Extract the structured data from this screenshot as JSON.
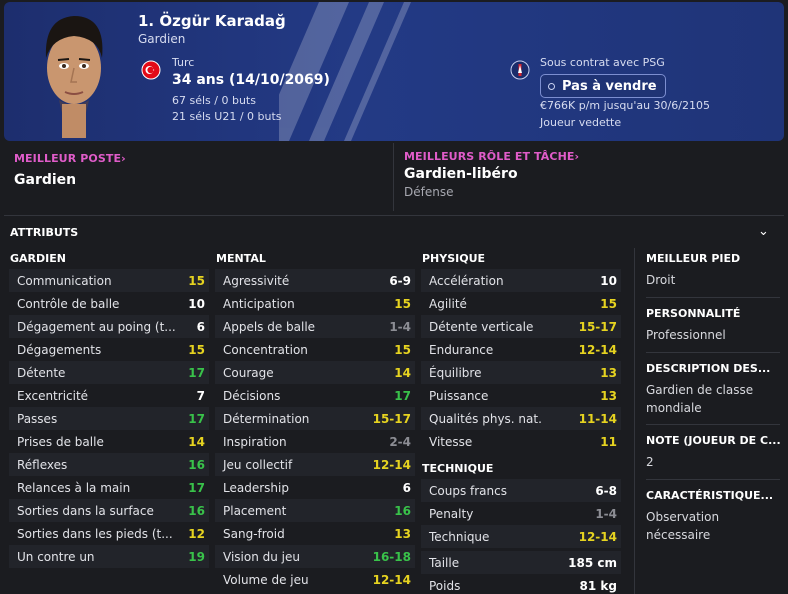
{
  "header": {
    "name": "1. Özgür Karadağ",
    "role": "Gardien",
    "nationality": "Turc",
    "age": "34 ans (14/10/2069)",
    "caps": "67 séls / 0 buts",
    "caps_u21": "21 séls U21 / 0 buts",
    "contract": "Sous contrat avec PSG",
    "sale_status": "Pas à vendre",
    "wage": "€766K p/m jusqu'au 30/6/2105",
    "squad_status": "Joueur vedette"
  },
  "best_position": {
    "title": "MEILLEUR POSTE",
    "value": "Gardien"
  },
  "best_role": {
    "title": "MEILLEURS RÔLE ET TÂCHE",
    "value": "Gardien-libéro",
    "duty": "Défense"
  },
  "attributes_title": "ATTRIBUTS",
  "colors": {
    "green": "#39c24a",
    "yellow": "#e6d320",
    "white": "#ffffff",
    "grey": "#8c8d94",
    "accent": "#e05cc9",
    "header_blue": "#233a85"
  },
  "gardien": {
    "title": "GARDIEN",
    "rows": [
      {
        "label": "Communication",
        "value": "15",
        "color": "yellow"
      },
      {
        "label": "Contrôle de balle",
        "value": "10",
        "color": "white"
      },
      {
        "label": "Dégagement au poing (t...",
        "value": "6",
        "color": "white"
      },
      {
        "label": "Dégagements",
        "value": "15",
        "color": "yellow"
      },
      {
        "label": "Détente",
        "value": "17",
        "color": "green"
      },
      {
        "label": "Excentricité",
        "value": "7",
        "color": "white"
      },
      {
        "label": "Passes",
        "value": "17",
        "color": "green"
      },
      {
        "label": "Prises de balle",
        "value": "14",
        "color": "yellow"
      },
      {
        "label": "Réflexes",
        "value": "16",
        "color": "green"
      },
      {
        "label": "Relances à la main",
        "value": "17",
        "color": "green"
      },
      {
        "label": "Sorties dans la surface",
        "value": "16",
        "color": "green"
      },
      {
        "label": "Sorties dans les pieds (t...",
        "value": "12",
        "color": "yellow"
      },
      {
        "label": "Un contre un",
        "value": "19",
        "color": "green"
      }
    ]
  },
  "mental": {
    "title": "MENTAL",
    "rows": [
      {
        "label": "Agressivité",
        "value": "6-9",
        "color": "white"
      },
      {
        "label": "Anticipation",
        "value": "15",
        "color": "yellow"
      },
      {
        "label": "Appels de balle",
        "value": "1-4",
        "color": "grey"
      },
      {
        "label": "Concentration",
        "value": "15",
        "color": "yellow"
      },
      {
        "label": "Courage",
        "value": "14",
        "color": "yellow"
      },
      {
        "label": "Décisions",
        "value": "17",
        "color": "green"
      },
      {
        "label": "Détermination",
        "value": "15-17",
        "color": "yellow"
      },
      {
        "label": "Inspiration",
        "value": "2-4",
        "color": "grey"
      },
      {
        "label": "Jeu collectif",
        "value": "12-14",
        "color": "yellow"
      },
      {
        "label": "Leadership",
        "value": "6",
        "color": "white"
      },
      {
        "label": "Placement",
        "value": "16",
        "color": "green"
      },
      {
        "label": "Sang-froid",
        "value": "13",
        "color": "yellow"
      },
      {
        "label": "Vision du jeu",
        "value": "16-18",
        "color": "green"
      },
      {
        "label": "Volume de jeu",
        "value": "12-14",
        "color": "yellow"
      }
    ]
  },
  "physique": {
    "title": "PHYSIQUE",
    "rows": [
      {
        "label": "Accélération",
        "value": "10",
        "color": "white"
      },
      {
        "label": "Agilité",
        "value": "15",
        "color": "yellow"
      },
      {
        "label": "Détente verticale",
        "value": "15-17",
        "color": "yellow"
      },
      {
        "label": "Endurance",
        "value": "12-14",
        "color": "yellow"
      },
      {
        "label": "Équilibre",
        "value": "13",
        "color": "yellow"
      },
      {
        "label": "Puissance",
        "value": "13",
        "color": "yellow"
      },
      {
        "label": "Qualités phys. nat.",
        "value": "11-14",
        "color": "yellow"
      },
      {
        "label": "Vitesse",
        "value": "11",
        "color": "yellow"
      }
    ]
  },
  "technique": {
    "title": "TECHNIQUE",
    "rows": [
      {
        "label": "Coups francs",
        "value": "6-8",
        "color": "white"
      },
      {
        "label": "Penalty",
        "value": "1-4",
        "color": "grey"
      },
      {
        "label": "Technique",
        "value": "12-14",
        "color": "yellow"
      }
    ]
  },
  "body": {
    "rows": [
      {
        "label": "Taille",
        "value": "185 cm",
        "color": "white"
      },
      {
        "label": "Poids",
        "value": "81 kg",
        "color": "white"
      }
    ]
  },
  "side": [
    {
      "title": "MEILLEUR PIED",
      "value": "Droit"
    },
    {
      "title": "PERSONNALITÉ",
      "value": "Professionnel"
    },
    {
      "title": "DESCRIPTION DES...",
      "value": "Gardien de classe mondiale"
    },
    {
      "title": "NOTE (JOUEUR DE C...",
      "value": "2"
    },
    {
      "title": "CARACTÉRISTIQUE...",
      "value": "Observation nécessaire"
    }
  ]
}
